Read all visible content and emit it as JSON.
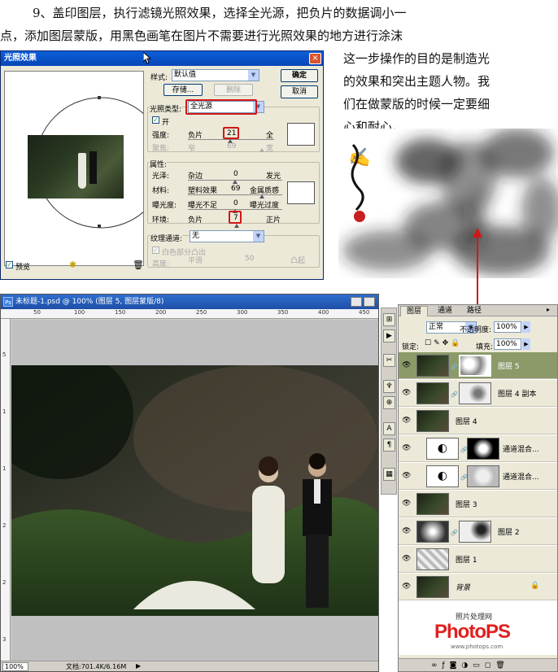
{
  "tutorial": {
    "line1": "9、盖印图层，执行滤镜光照效果，选择全光源，把负片的数据调小一",
    "line2": "点，添加图层蒙版，用黑色画笔在图片不需要进行光照效果的地方进行涂沫",
    "side": [
      "这一步操作的目的是制造光",
      "的效果和突出主题人物。我",
      "们在做蒙版的时候一定要细",
      "心和耐心。"
    ]
  },
  "dialog": {
    "title": "光照效果",
    "close": "×",
    "style_label": "样式:",
    "style_value": "默认值",
    "ok": "确定",
    "cancel": "取消",
    "save": "存储...",
    "delete": "删除",
    "light_type_label": "光照类型:",
    "light_type_value": "全光源",
    "on_label": "开",
    "intensity_label": "强度:",
    "intensity_left": "负片",
    "intensity_value": "21",
    "intensity_right": "全",
    "focus_label": "聚焦:",
    "focus_left": "窄",
    "focus_value": "69",
    "focus_right": "宽",
    "props_label": "属性:",
    "gloss_label": "光泽:",
    "gloss_left": "杂边",
    "gloss_value": "0",
    "gloss_right": "发光",
    "material_label": "材料:",
    "material_left": "塑料效果",
    "material_value": "69",
    "material_right": "金属质感",
    "exposure_label": "曝光度:",
    "exposure_left": "曝光不足",
    "exposure_value": "0",
    "exposure_right": "曝光过度",
    "ambience_label": "环境:",
    "ambience_left": "负片",
    "ambience_value": "7",
    "ambience_right": "正片",
    "texture_label": "纹理通道:",
    "texture_value": "无",
    "white_high_label": "白色部分凸出",
    "height_label": "高度:",
    "height_left": "平滑",
    "height_value": "50",
    "height_right": "凸起",
    "preview_label": "预览"
  },
  "ps": {
    "title": "未标题-1.psd @ 100% (图层 5, 图层蒙版/8)",
    "zoom": "100%",
    "doc_info": "文档:701.4K/6.16M",
    "ruler_top": [
      "50",
      "100",
      "150",
      "200",
      "250",
      "300",
      "350",
      "400",
      "450"
    ],
    "ruler_left": [
      "5",
      "1",
      "1",
      "2",
      "2",
      "3"
    ]
  },
  "layers": {
    "tabs": [
      "图层",
      "通道",
      "路径"
    ],
    "blend_mode": "正常",
    "opacity_label": "不透明度:",
    "opacity_value": "100%",
    "lock_label": "锁定:",
    "fill_label": "填充:",
    "fill_value": "100%",
    "rows": [
      {
        "name": "图层 5",
        "active": true
      },
      {
        "name": "图层 4 副本",
        "active": false
      },
      {
        "name": "图层 4",
        "active": false
      },
      {
        "name": "通道混合...",
        "active": false
      },
      {
        "name": "通道混合...",
        "active": false
      },
      {
        "name": "图层 3",
        "active": false
      },
      {
        "name": "图层 2",
        "active": false
      },
      {
        "name": "图层 1",
        "active": false
      },
      {
        "name": "背景",
        "active": false
      }
    ],
    "watermark_site": "照片处理网",
    "watermark_logo": "PhotoPS",
    "watermark_url": "www.photops.com"
  }
}
